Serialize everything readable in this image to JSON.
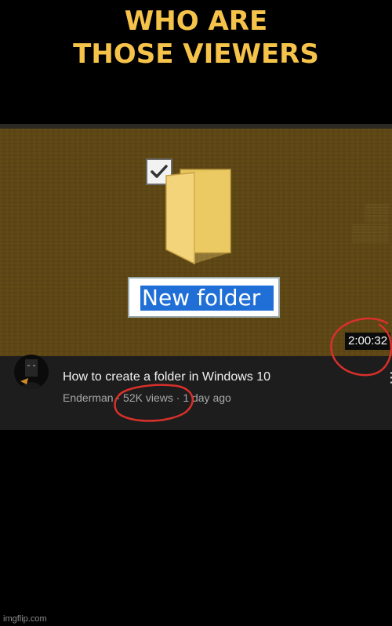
{
  "meme": {
    "caption_line1": "WHO ARE",
    "caption_line2": "THOSE VIEWERS",
    "caption_color": "#f5c24a",
    "watermark": "imgflip.com"
  },
  "video": {
    "thumbnail": {
      "rename_text": "New folder",
      "checkbox_checked": true,
      "duration": "2:00:32"
    },
    "title": "How to create a folder in Windows 10",
    "channel": "Enderman",
    "separator": " · ",
    "views": "52K views",
    "age": "1 day ago",
    "menu_glyph": "⋮"
  },
  "annotations": {
    "circle_color": "#d9302a",
    "circled_items": [
      "duration",
      "views"
    ]
  },
  "icons": {
    "folder": "folder-icon",
    "checkbox": "checkbox-icon",
    "avatar": "avatar",
    "menu": "more-vert-icon"
  }
}
